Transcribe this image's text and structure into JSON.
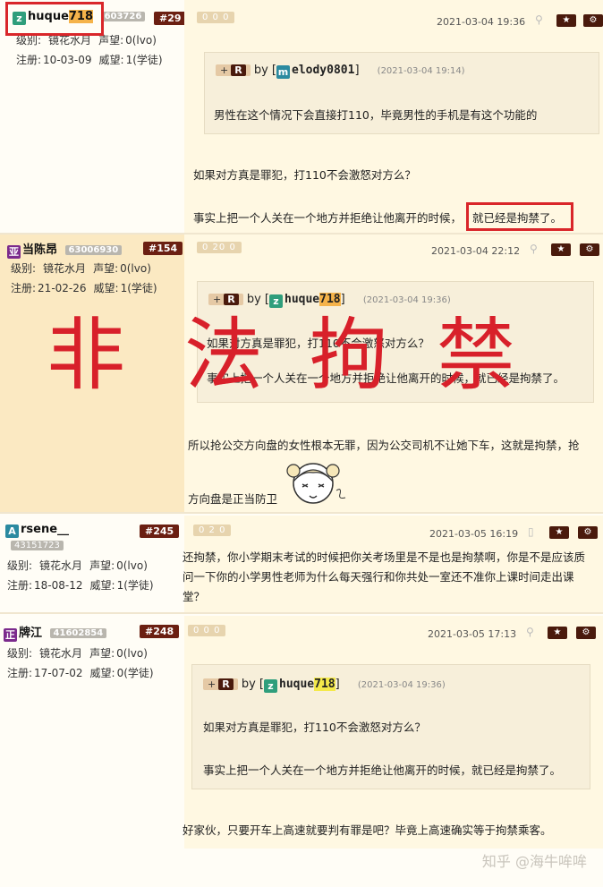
{
  "posts": [
    {
      "user": {
        "avatar_char": "z",
        "name_main": "huque",
        "name_hl": "718",
        "uid": "603726",
        "floor": "#29"
      },
      "stats": {
        "level_label": "级别:",
        "level": "镜花水月",
        "rep_label": "声望:",
        "rep": "0(lvo)",
        "reg_label": "注册:",
        "reg": "10-03-09",
        "prestige_label": "威望:",
        "prestige": "1(学徒)"
      },
      "badge": "0 0 0",
      "date": "2021-03-04 19:36",
      "quote": {
        "tag": "+",
        "tag_r": "R",
        "by": "by [",
        "avatar_char": "m",
        "name": "elody0801",
        "close": "]",
        "date": "(2021-03-04 19:14)",
        "text": "男性在这个情况下会直接打110，毕竟男性的手机是有这个功能的"
      },
      "lines": [
        "如果对方真是罪犯，打110不会激怒对方么？",
        "事实上把一个人关在一个地方并拒绝让他离开的时候，",
        "就已经是拘禁了。"
      ]
    },
    {
      "user": {
        "avatar_char": "亚",
        "name_main": "当陈昂",
        "uid": "63006930",
        "floor": "#154"
      },
      "stats": {
        "level_label": "级别:",
        "level": "镜花水月",
        "rep_label": "声望:",
        "rep": "0(lvo)",
        "reg_label": "注册:",
        "reg": "21-02-26",
        "prestige_label": "威望:",
        "prestige": "1(学徒)"
      },
      "badge": "0 20 0",
      "date": "2021-03-04 22:12",
      "quote": {
        "tag": "+",
        "tag_r": "R",
        "by": "by [",
        "avatar_char": "z",
        "name": "huque",
        "name_hl": "718",
        "close": "]",
        "date": "(2021-03-04 19:36)",
        "line1": "如果对方真是罪犯，打110不会激怒对方么？",
        "line2": "事实上把一个人关在一个地方并拒绝让他离开的时候，就已经是拘禁了。"
      },
      "lines": [
        "所以抢公交方向盘的女性根本无罪，因为公交司机不让她下车，这就是拘禁，抢",
        "方向盘是正当防卫"
      ],
      "overlay": [
        "非",
        "法",
        "拘",
        "禁"
      ]
    },
    {
      "user": {
        "avatar_char": "A",
        "name_main": "rsene__",
        "uid": "43151723",
        "floor": "#245"
      },
      "stats": {
        "level_label": "级别:",
        "level": "镜花水月",
        "rep_label": "声望:",
        "rep": "0(lvo)",
        "reg_label": "注册:",
        "reg": "18-08-12",
        "prestige_label": "威望:",
        "prestige": "1(学徒)"
      },
      "badge": "0 2 0",
      "date": "2021-03-05 16:19",
      "text": "还拘禁，你小学期末考试的时候把你关考场里是不是也是拘禁啊，你是不是应该质问一下你的小学男性老师为什么每天强行和你共处一室还不准你上课时间走出课堂？"
    },
    {
      "user": {
        "avatar_char": "正",
        "name_main": "牌江",
        "uid": "41602854",
        "floor": "#248"
      },
      "stats": {
        "level_label": "级别:",
        "level": "镜花水月",
        "rep_label": "声望:",
        "rep": "0(lvo)",
        "reg_label": "注册:",
        "reg": "17-07-02",
        "prestige_label": "威望:",
        "prestige": "0(学徒)"
      },
      "badge": "0 0 0",
      "date": "2021-03-05 17:13",
      "quote": {
        "tag": "+",
        "tag_r": "R",
        "by": "by [",
        "avatar_char": "z",
        "name": "huque",
        "name_hl": "718",
        "close": "]",
        "date": "(2021-03-04 19:36)",
        "line1": "如果对方真是罪犯，打110不会激怒对方么？",
        "line2": "事实上把一个人关在一个地方并拒绝让他离开的时候，就已经是拘禁了。"
      },
      "lines": [
        "好家伙，只要开车上高速就要判有罪是吧？毕竟上高速确实等于拘禁乘客。"
      ]
    }
  ],
  "buttons": {
    "star": "★",
    "gear": "⚙"
  },
  "watermark": "知乎 @海牛哞哞",
  "colors": {
    "accent": "#6b1f12",
    "red_annotation": "#d9262a",
    "background": "#fff8e2"
  }
}
